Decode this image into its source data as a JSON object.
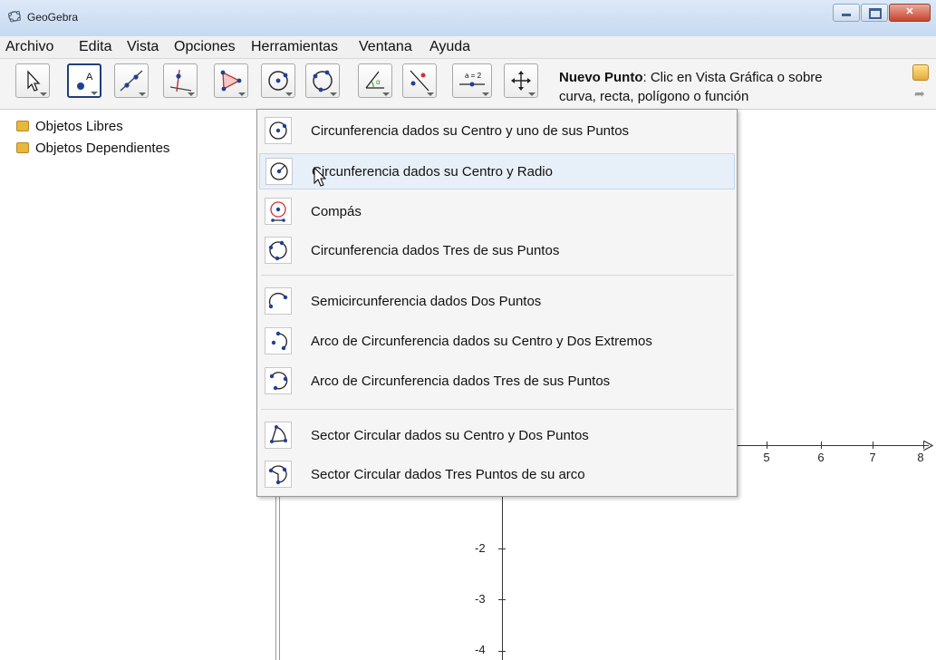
{
  "window": {
    "title": "GeoGebra",
    "icon": "geogebra-icon",
    "buttons": [
      "minimize-icon",
      "maximize-icon",
      "close-icon"
    ]
  },
  "menubar": {
    "items": [
      "Archivo",
      "Edita",
      "Vista",
      "Opciones",
      "Herramientas",
      "Ventana",
      "Ayuda"
    ]
  },
  "toolbar": {
    "tools": [
      {
        "icon": "move-arrow-icon"
      },
      {
        "icon": "point-icon",
        "selected": true
      },
      {
        "icon": "line-icon"
      },
      {
        "icon": "perpendicular-line-icon"
      },
      {
        "icon": "polygon-icon"
      },
      {
        "icon": "circle-center-point-icon"
      },
      {
        "icon": "circle-three-points-icon"
      },
      {
        "icon": "angle-icon"
      },
      {
        "icon": "reflect-icon"
      },
      {
        "icon": "slider-icon",
        "text": "a = 2"
      },
      {
        "icon": "move-graphics-view-icon"
      }
    ],
    "help_title": "Nuevo Punto",
    "help_text": ": Clic en Vista Gráfica o sobre",
    "help_text2": "curva, recta, polígono o función",
    "undo_icon": "undo-icon",
    "redo_icon": "redo-icon"
  },
  "algebra": {
    "folders": [
      "Objetos Libres",
      "Objetos Dependientes"
    ]
  },
  "graphics": {
    "x_ticks": [
      "5",
      "6",
      "7",
      "8"
    ],
    "y_ticks": [
      "-2",
      "-3",
      "-4"
    ]
  },
  "dropdown": {
    "items": [
      {
        "label": "Circunferencia dados su Centro y uno de sus Puntos",
        "icon": "circle-center-point-icon"
      },
      {
        "label": "Circunferencia dados su Centro y Radio",
        "icon": "circle-center-radius-icon",
        "highlighted": true
      },
      {
        "label": "Compás",
        "icon": "compass-icon"
      },
      {
        "label": "Circunferencia dados Tres de sus Puntos",
        "icon": "circle-three-points-icon"
      },
      {
        "label": "Semicircunferencia dados Dos Puntos",
        "icon": "semicircle-icon"
      },
      {
        "label": "Arco de Circunferencia dados su Centro y Dos Extremos",
        "icon": "circular-arc-center-icon"
      },
      {
        "label": "Arco de Circunferencia dados Tres de sus Puntos",
        "icon": "circumcircular-arc-icon"
      },
      {
        "label": "Sector Circular dados su Centro y Dos Puntos",
        "icon": "circular-sector-center-icon"
      },
      {
        "label": "Sector Circular dados Tres Puntos de su arco",
        "icon": "circumcircular-sector-icon"
      }
    ]
  },
  "colors": {
    "accent": "#1f3f7a",
    "highlight": "#e7f0f8",
    "point_blue": "#1f3f99"
  }
}
